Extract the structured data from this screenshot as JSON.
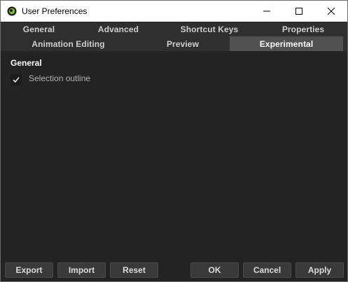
{
  "window": {
    "title": "User Preferences"
  },
  "tabs": {
    "row1": [
      "General",
      "Advanced",
      "Shortcut Keys",
      "Properties"
    ],
    "row2": [
      "Animation Editing",
      "Preview",
      "Experimental"
    ],
    "active": "Experimental"
  },
  "content": {
    "section_heading": "General",
    "options": [
      {
        "label": "Selection outline",
        "checked": true
      }
    ]
  },
  "footer": {
    "export": "Export",
    "import": "Import",
    "reset": "Reset",
    "ok": "OK",
    "cancel": "Cancel",
    "apply": "Apply"
  }
}
